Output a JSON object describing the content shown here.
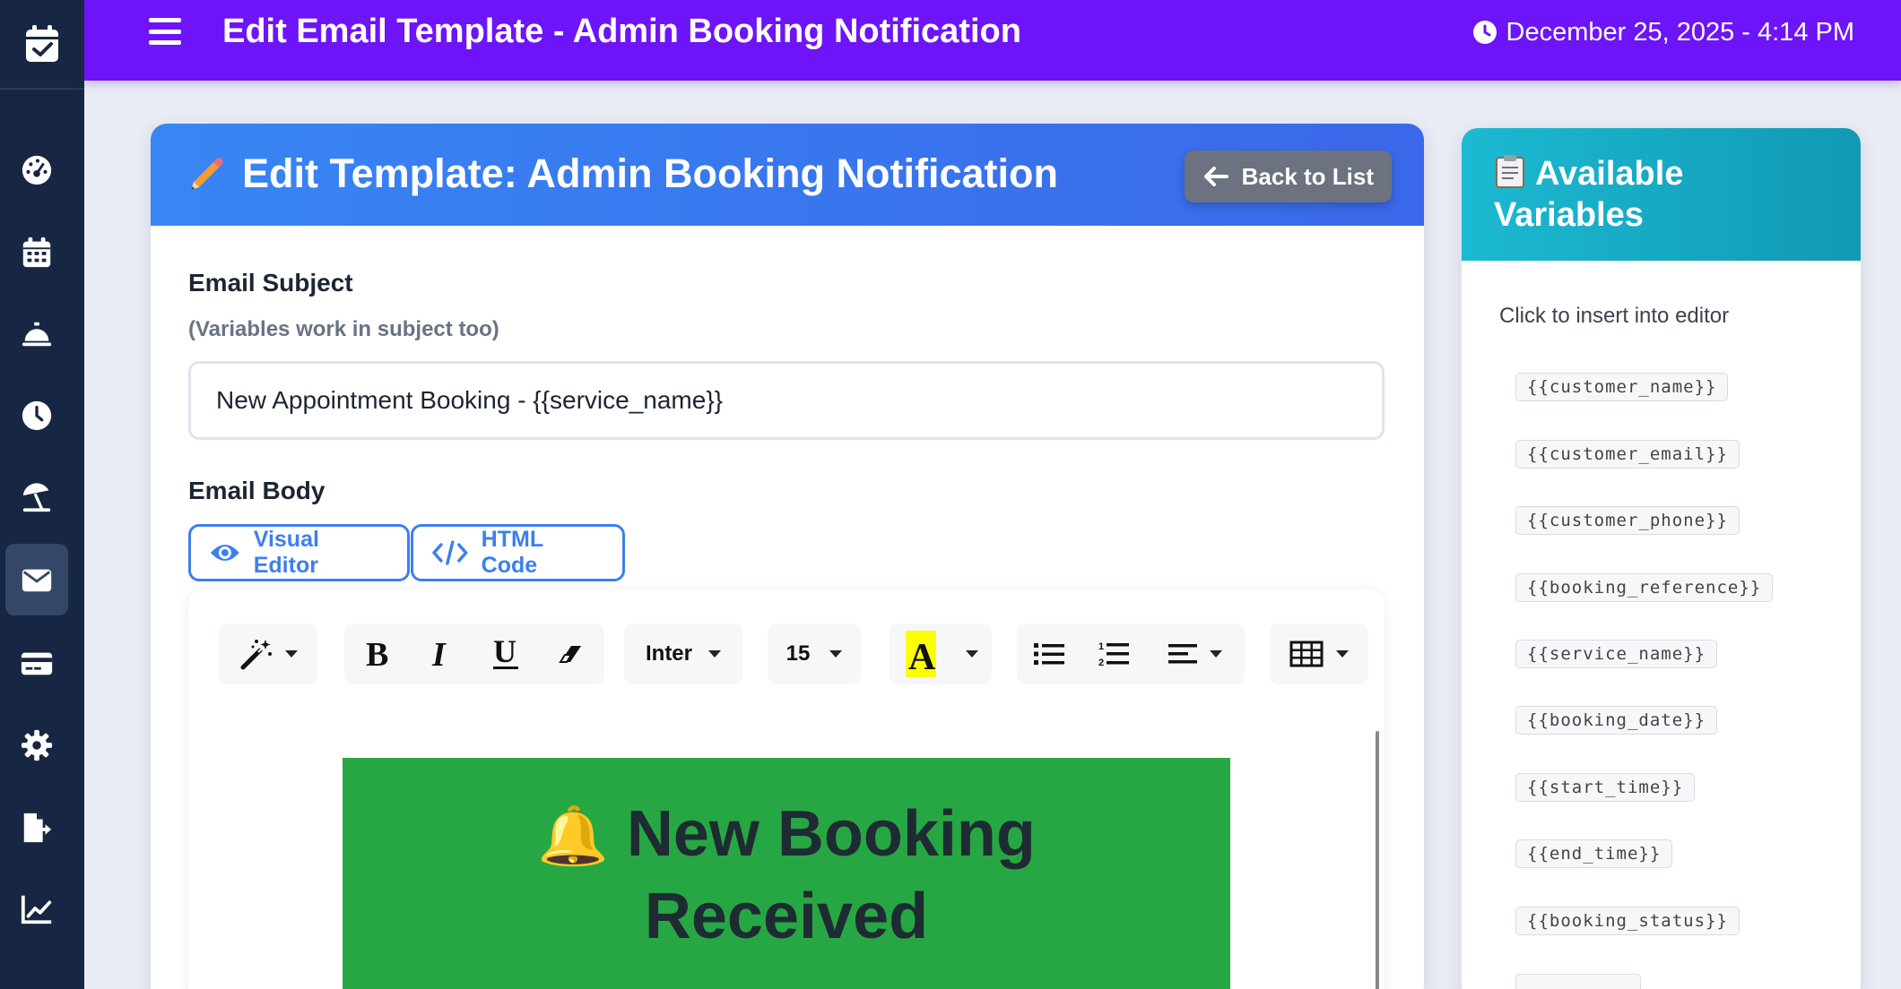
{
  "header": {
    "title": "Edit Email Template - Admin Booking Notification",
    "datetime": "December 25, 2025 - 4:14 PM"
  },
  "sidebar": {
    "items": [
      {
        "icon": "dashboard-icon"
      },
      {
        "icon": "calendar-icon"
      },
      {
        "icon": "service-bell-icon"
      },
      {
        "icon": "clock-icon"
      },
      {
        "icon": "beach-umbrella-icon"
      },
      {
        "icon": "envelope-icon",
        "active": true
      },
      {
        "icon": "credit-card-icon"
      },
      {
        "icon": "gear-icon"
      },
      {
        "icon": "file-export-icon"
      },
      {
        "icon": "chart-line-icon"
      }
    ]
  },
  "card": {
    "title": "Edit Template: Admin Booking Notification",
    "back_label": "Back to List",
    "subject_label": "Email Subject",
    "subject_hint": "(Variables work in subject too)",
    "subject_value": "New Appointment Booking - {{service_name}}",
    "body_label": "Email Body",
    "visual_editor_label": "Visual Editor",
    "html_code_label": "HTML Code"
  },
  "toolbar": {
    "font": "Inter",
    "size": "15"
  },
  "preview": {
    "emoji": "🔔",
    "heading_line1": "New Booking",
    "heading_line2": "Received"
  },
  "variables": {
    "title_line1": "Available",
    "title_line2": "Variables",
    "hint": "Click to insert into editor",
    "items": [
      "{{customer_name}}",
      "{{customer_email}}",
      "{{customer_phone}}",
      "{{booking_reference}}",
      "{{service_name}}",
      "{{booking_date}}",
      "{{start_time}}",
      "{{end_time}}",
      "{{booking_status}}"
    ]
  },
  "colors": {
    "header": "#6d14f9",
    "sidebar": "#172642",
    "card_header": "#3a78ef",
    "variables_header": "#17aac4",
    "banner": "#27a743",
    "accent": "#3d80ec"
  }
}
